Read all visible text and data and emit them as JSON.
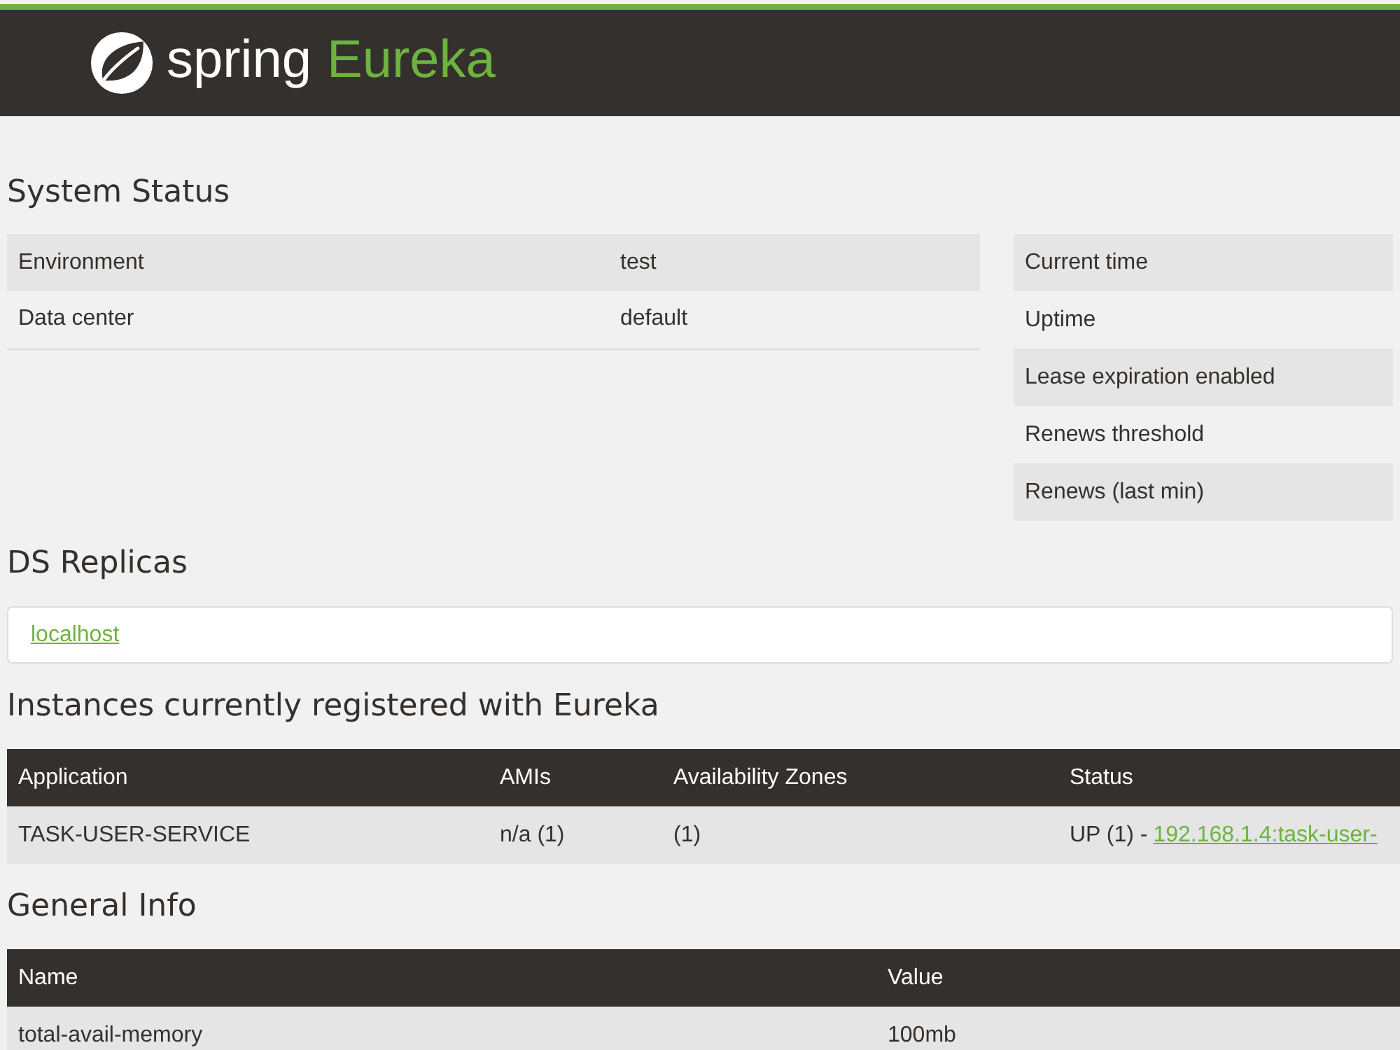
{
  "header": {
    "brand": "spring",
    "product": "Eureka"
  },
  "system_status": {
    "title": "System Status",
    "environment_rows": [
      {
        "label": "Environment",
        "value": "test"
      },
      {
        "label": "Data center",
        "value": "default"
      }
    ],
    "runtime_labels": [
      "Current time",
      "Uptime",
      "Lease expiration enabled",
      "Renews threshold",
      "Renews (last min)"
    ]
  },
  "ds_replicas": {
    "title": "DS Replicas",
    "replicas": [
      "localhost"
    ]
  },
  "instances": {
    "title": "Instances currently registered with Eureka",
    "columns": [
      "Application",
      "AMIs",
      "Availability Zones",
      "Status"
    ],
    "rows": [
      {
        "application": "TASK-USER-SERVICE",
        "amis": "n/a (1)",
        "availability_zones": "(1)",
        "status": "UP (1) -",
        "instance": "192.168.1.4:task-user-"
      }
    ]
  },
  "general_info": {
    "title": "General Info",
    "columns": [
      "Name",
      "Value"
    ],
    "rows": [
      {
        "name": "total-avail-memory",
        "value": "100mb"
      }
    ]
  }
}
